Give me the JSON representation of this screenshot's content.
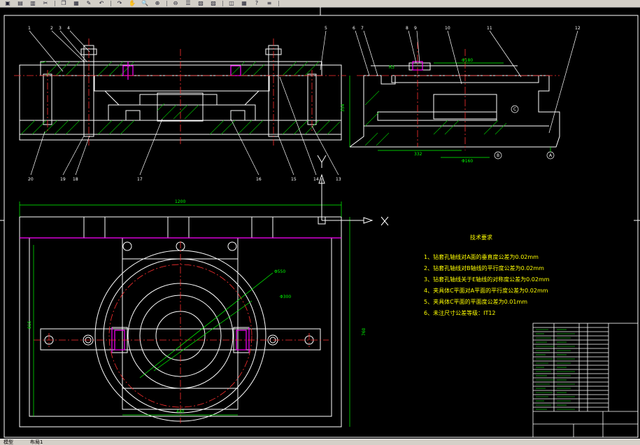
{
  "toolbar": {
    "icons": [
      "save-icon",
      "print-icon",
      "preview-icon",
      "cut-icon",
      "copy-icon",
      "paste-icon",
      "match-prop-icon",
      "undo-icon",
      "redo-icon",
      "pan-icon",
      "zoom-realtime-icon",
      "zoom-window-icon",
      "zoom-previous-icon",
      "properties-icon",
      "design-center-icon",
      "tool-palette-icon",
      "layer-icon",
      "grid-icon",
      "help-icon",
      "layers-icon"
    ],
    "glyphs": [
      "▣",
      "▤",
      "▥",
      "✂",
      "❐",
      "▦",
      "✎",
      "↶",
      "↷",
      "✋",
      "🔍",
      "⊕",
      "⊖",
      "☰",
      "▧",
      "▨",
      "◫",
      "▦",
      "?",
      "≡"
    ]
  },
  "tech_requirements": {
    "title": "技术要求",
    "items": [
      "1、钻套孔轴线对A面的垂直度公差为0.02mm",
      "2、钻套孔轴线对B轴线的平行度公差为0.02mm",
      "3、钻套孔轴线关于E轴线的对称度公差为0.02mm",
      "4、夹具体C平面对A平面的平行度公差为0.02mm",
      "5、夹具体C平面的平面度公差为0.01mm",
      "6、未注尺寸公差等级：IT12"
    ]
  },
  "dimensions": {
    "width_1200": "1200",
    "width_440": "440",
    "height_760": "760",
    "height_815": "815",
    "dia_300": "Φ300",
    "dia_550": "Φ550",
    "height_354": "354",
    "dim_332": "332",
    "dim_r3": "R3",
    "dim_dia160": "Φ160",
    "dim_dia180": "Φ180"
  },
  "balloons_left": [
    "1",
    "2",
    "3",
    "4",
    "5"
  ],
  "balloons_left_bottom": [
    "20",
    "19",
    "18",
    "17",
    "16",
    "15",
    "14",
    "13"
  ],
  "balloons_right": [
    "6",
    "7",
    "8",
    "9",
    "10",
    "11",
    "12"
  ],
  "datums": {
    "a": "A",
    "b": "B",
    "c": "C"
  },
  "ucs": {
    "x": "X",
    "y": "Y"
  },
  "statusbar": {
    "model_tab": "模型",
    "layout_tab": "布局1"
  },
  "colors": {
    "background": "#000000",
    "outline": "#ffffff",
    "dimension": "#00ff00",
    "hatch": "#00c000",
    "center": "#ff3030",
    "magenta": "#ff00ff",
    "text": "#ffff00",
    "cyan": "#00ffff"
  }
}
